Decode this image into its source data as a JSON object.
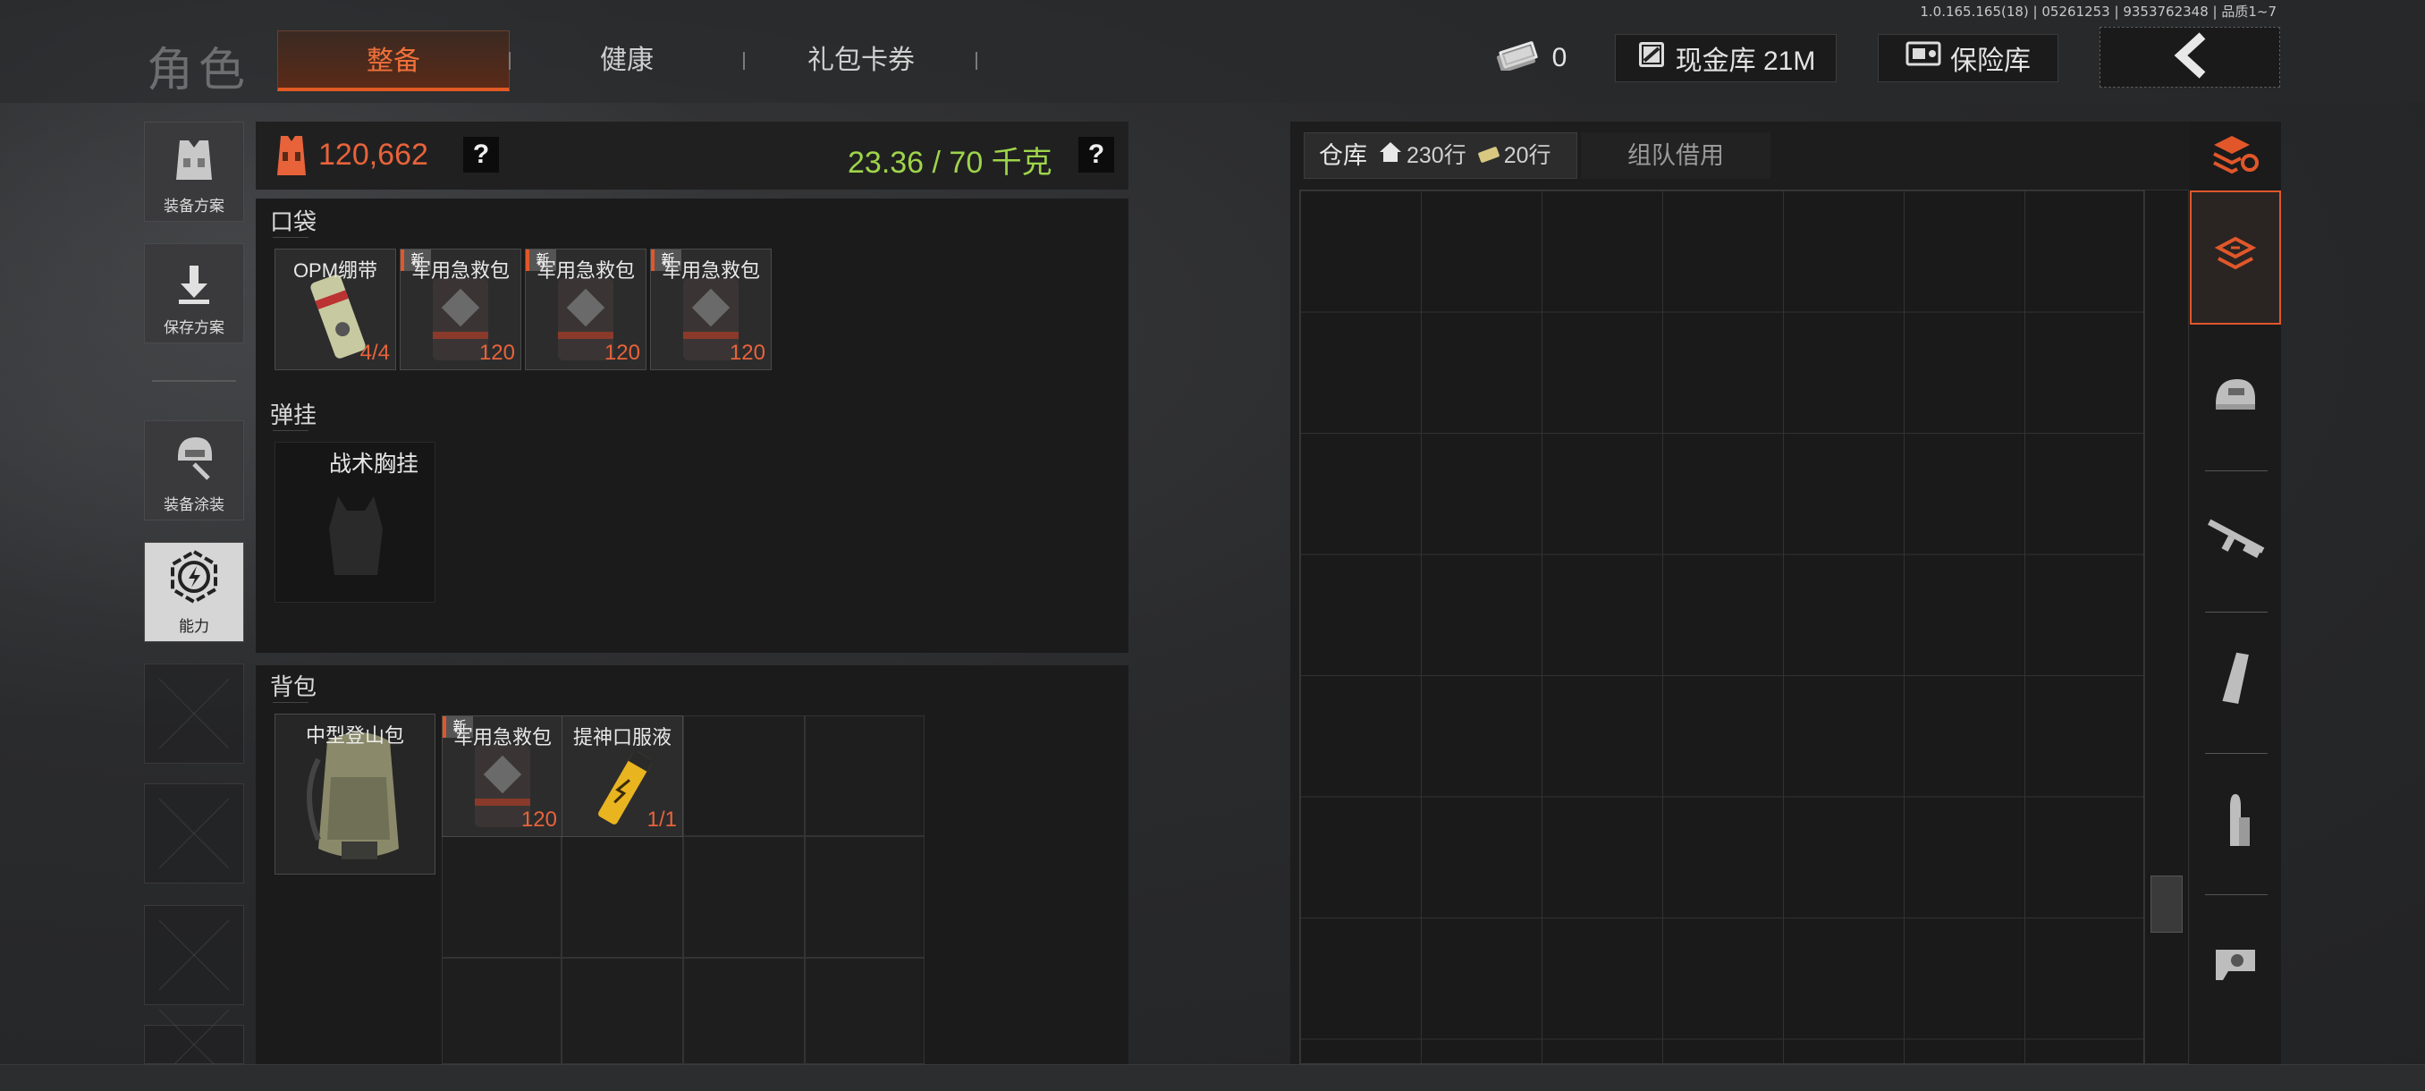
{
  "version_info": "1.0.165.165(18) | 05261253 | 9353762348 | 品质1~7",
  "page_title": "角色",
  "tabs": [
    {
      "label": "整备",
      "active": true
    },
    {
      "label": "健康",
      "active": false
    },
    {
      "label": "礼包卡券",
      "active": false
    }
  ],
  "currencies": {
    "tickets": "0",
    "cash_vault": "现金库 21M",
    "safe_vault": "保险库"
  },
  "sidebar": {
    "buttons": [
      {
        "label": "装备方案",
        "icon": "vest-icon"
      },
      {
        "label": "保存方案",
        "icon": "download-icon"
      },
      {
        "label": "装备涂装",
        "icon": "helmet-paint-icon"
      },
      {
        "label": "能力",
        "icon": "lightning-hex-icon"
      }
    ]
  },
  "loadout": {
    "value": "120,662",
    "weight": "23.36 / 70 千克",
    "help": "?",
    "pockets": {
      "title": "口袋",
      "items": [
        {
          "name": "OPM绷带",
          "count": "4/4",
          "new": false
        },
        {
          "name": "军用急救包",
          "count": "120",
          "new": true
        },
        {
          "name": "军用急救包",
          "count": "120",
          "new": true
        },
        {
          "name": "军用急救包",
          "count": "120",
          "new": true
        }
      ]
    },
    "chest_rig": {
      "title": "弹挂",
      "slot_label": "战术胸挂"
    },
    "backpack": {
      "title": "背包",
      "equipped": "中型登山包",
      "items": [
        {
          "name": "军用急救包",
          "count": "120",
          "new": true
        },
        {
          "name": "提神口服液",
          "count": "1/1",
          "new": false
        }
      ]
    },
    "new_tag": "新"
  },
  "warehouse": {
    "label": "仓库",
    "rows": "230行",
    "extra_rows": "20行",
    "team_borrow": "组队借用"
  },
  "categories": [
    "sort-icon",
    "all-items-icon",
    "helmet-icon",
    "rifle-icon",
    "magazine-icon",
    "ammo-icon",
    "scope-icon"
  ],
  "colors": {
    "accent": "#e1572a",
    "weight_green": "#9ed44a",
    "value_orange": "#e8633a"
  }
}
